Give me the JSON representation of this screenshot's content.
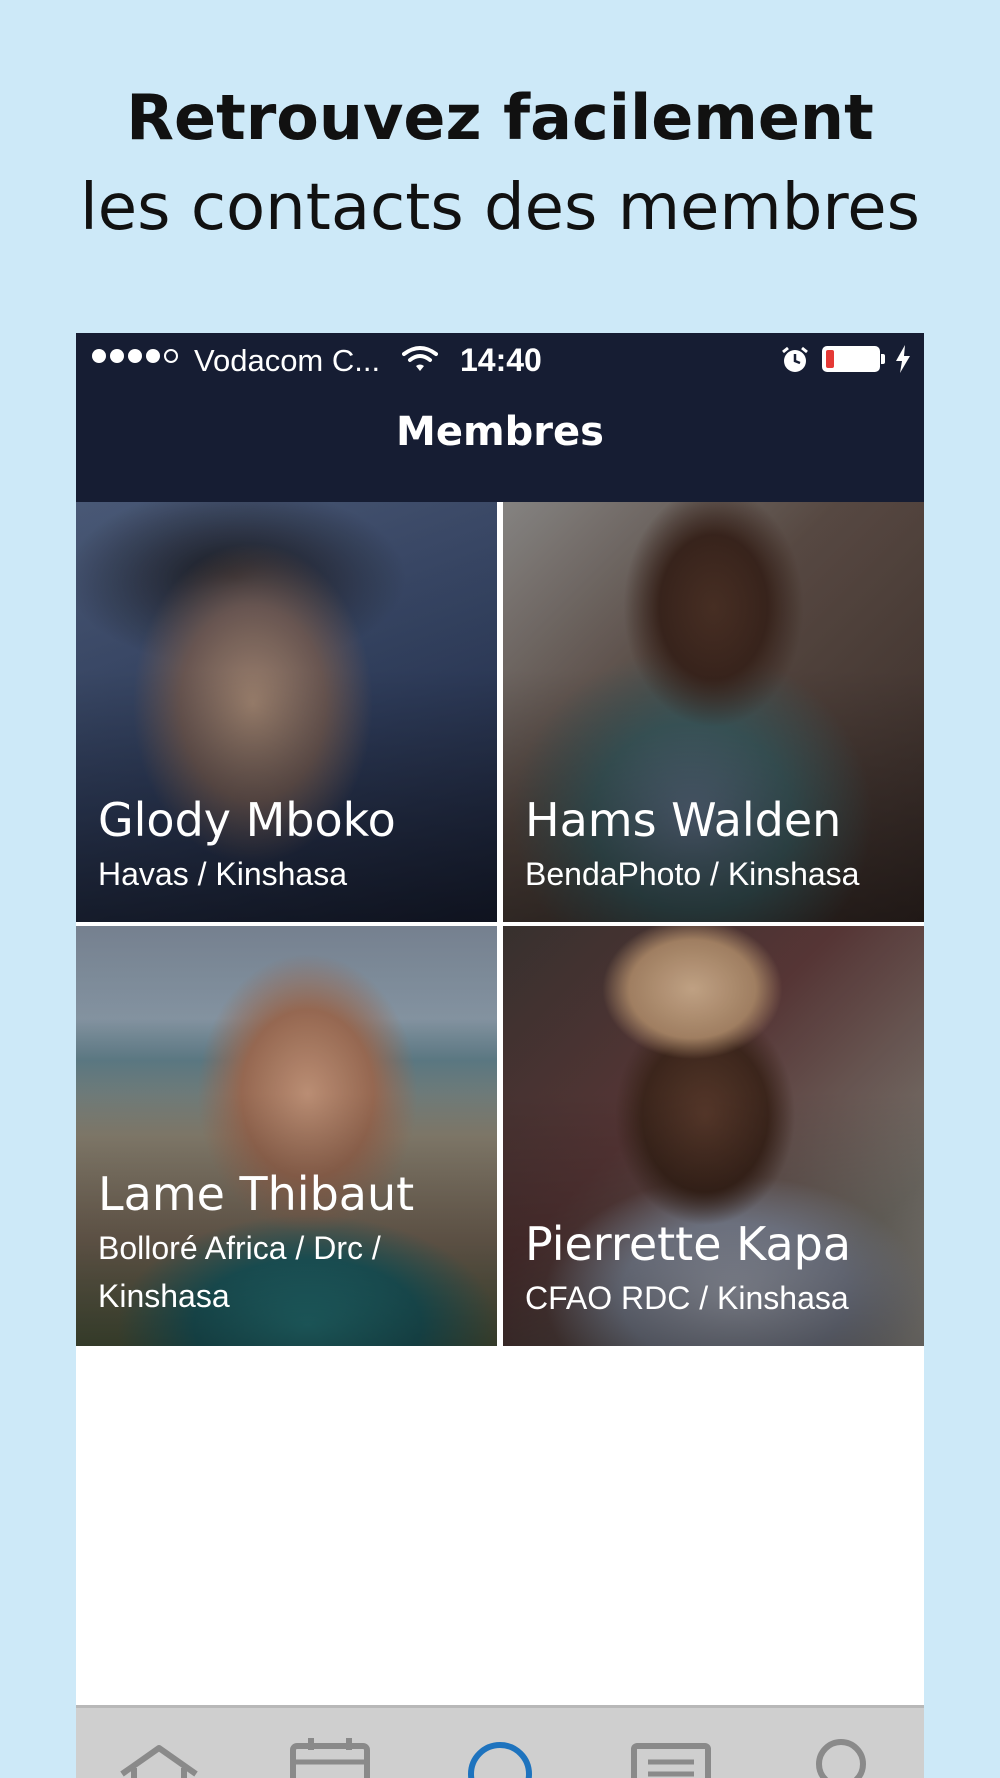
{
  "headline": {
    "line1": "Retrouvez facilement",
    "line2": "les contacts des membres"
  },
  "statusbar": {
    "carrier": "Vodacom C...",
    "time": "14:40",
    "signal_bars": 4,
    "battery_level": 0.15
  },
  "navbar": {
    "title": "Membres"
  },
  "members": [
    {
      "name": "Glody Mboko",
      "company": "Havas / Kinshasa"
    },
    {
      "name": "Hams Walden",
      "company": "BendaPhoto / Kinshasa"
    },
    {
      "name": "Lame Thibaut",
      "company": "Bolloré Africa / Drc / Kinshasa"
    },
    {
      "name": "Pierrette Kapa",
      "company": "CFAO RDC / Kinshasa"
    }
  ],
  "tabbar": {
    "tabs": [
      {
        "icon": "home-icon"
      },
      {
        "icon": "calendar-icon"
      },
      {
        "icon": "members-icon",
        "active": true
      },
      {
        "icon": "news-icon"
      },
      {
        "icon": "profile-icon"
      }
    ]
  },
  "colors": {
    "page_background": "#cde9f8",
    "navbar": "#161d33",
    "active_tab": "#1e73be",
    "tab_icon": "#8a8a8a",
    "battery_low": "#e53935"
  }
}
